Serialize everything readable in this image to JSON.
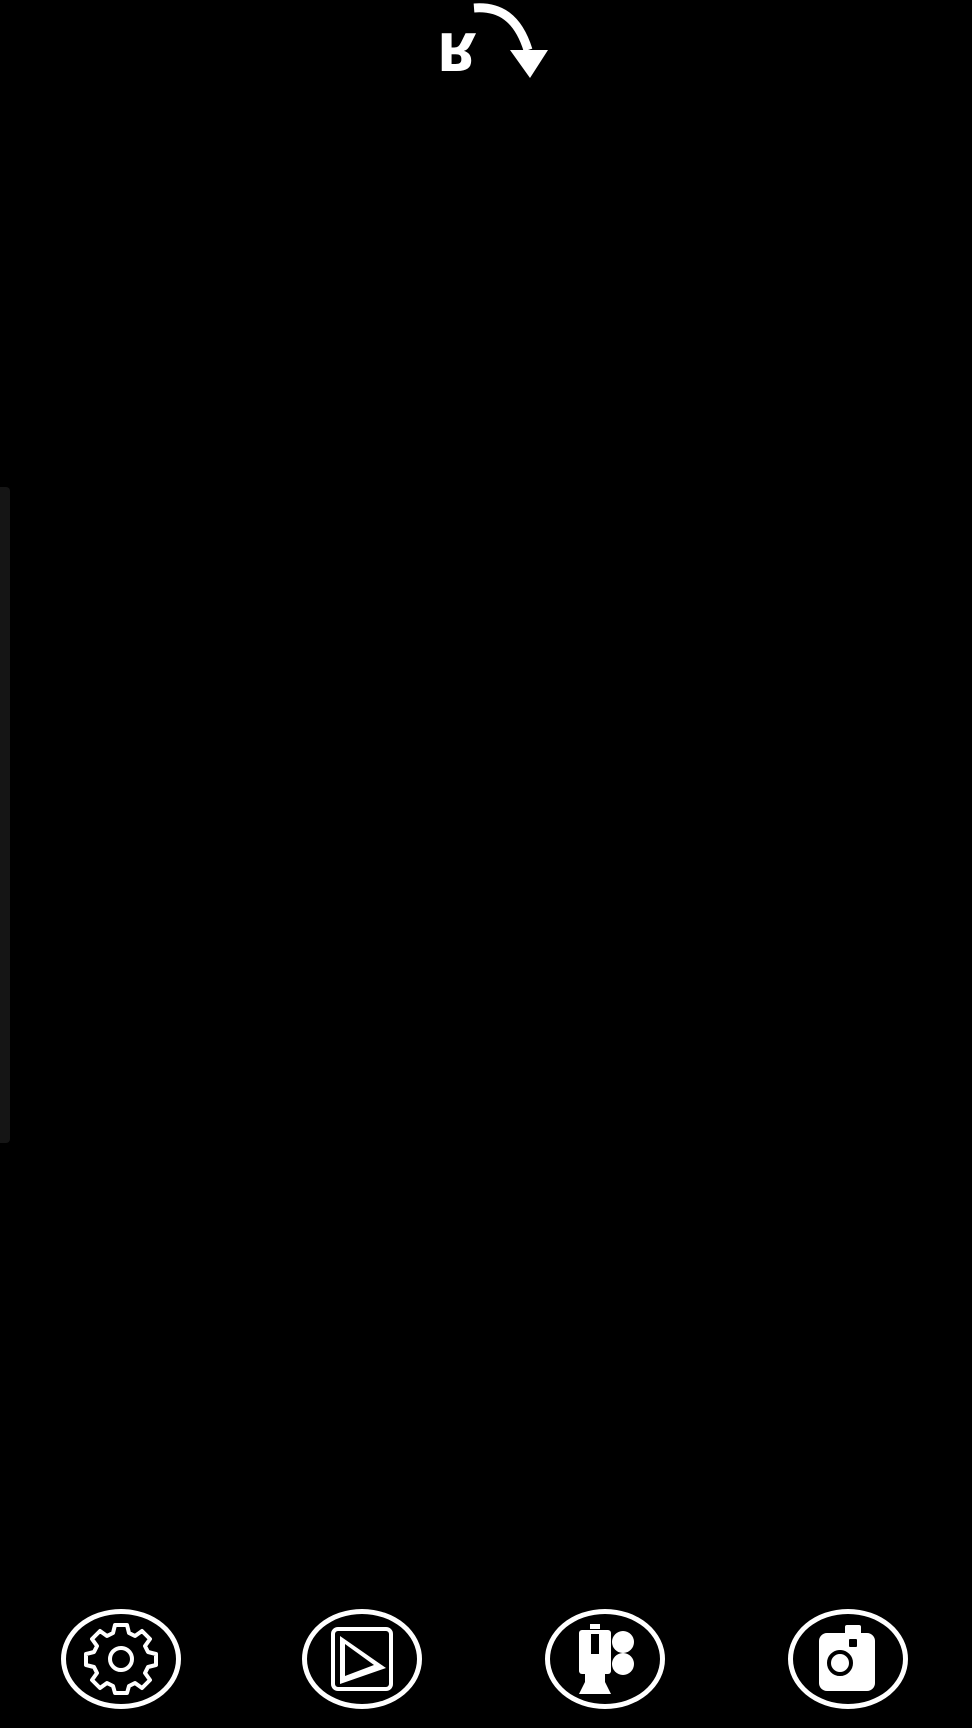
{
  "top_controls": {
    "rotate_letter": "R",
    "rotate_icon": "rotate-clockwise-arrow-icon"
  },
  "bottom_bar": {
    "buttons": [
      {
        "name": "settings",
        "icon": "gear-icon"
      },
      {
        "name": "gallery",
        "icon": "play-gallery-icon"
      },
      {
        "name": "video",
        "icon": "video-camera-icon"
      },
      {
        "name": "camera",
        "icon": "camera-icon"
      }
    ]
  },
  "colors": {
    "background": "#000000",
    "foreground": "#ffffff",
    "edge_handle": "#151515"
  }
}
